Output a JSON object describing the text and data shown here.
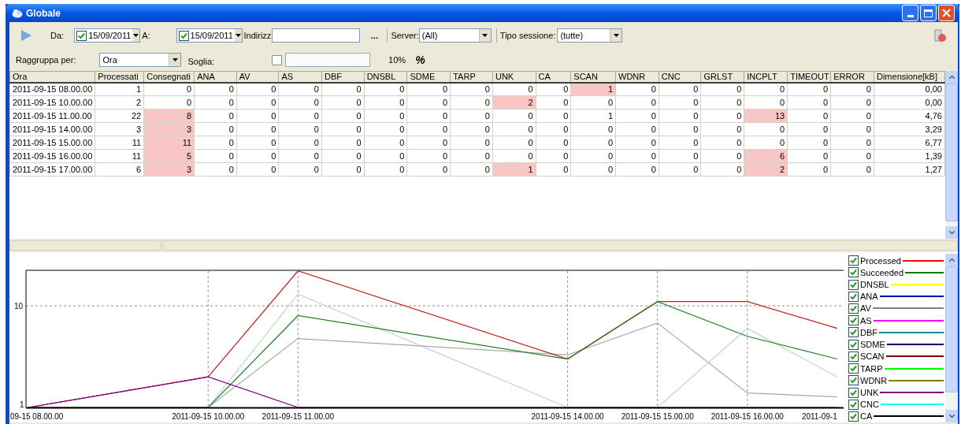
{
  "window": {
    "title": "Globale"
  },
  "toolbar": {
    "from_label": "Da:",
    "from_date": {
      "checked": true,
      "value": "15/09/2011"
    },
    "to_label": "A:",
    "to_date": {
      "checked": true,
      "value": "15/09/2011"
    },
    "address_label": "Indirizz",
    "browse_button": "...",
    "server_label": "Server:",
    "server": "(All)",
    "session_label": "Tipo sessione:",
    "session": "(tutte)"
  },
  "grouping": {
    "label": "Raggruppa per:",
    "value": "Ora",
    "threshold_label": "Soglia:",
    "threshold_checked": false,
    "threshold_percent": "10%",
    "percent_button": "%"
  },
  "table": {
    "columns": [
      "Ora",
      "Processati",
      "Consegnati",
      "ANA",
      "AV",
      "AS",
      "DBF",
      "DNSBL",
      "SDME",
      "TARP",
      "UNK",
      "CA",
      "SCAN",
      "WDNR",
      "CNC",
      "GRLST",
      "INCPLT",
      "TIMEOUT",
      "ERROR",
      "Dimensione[kB]"
    ],
    "rows": [
      [
        "2011-09-15 08.00.00",
        "1",
        "0",
        "0",
        "0",
        "0",
        "0",
        "0",
        "0",
        "0",
        "0",
        "0",
        {
          "text": "1",
          "highlighted": true
        },
        "0",
        "0",
        "0",
        "0",
        "0",
        "0",
        "0,00"
      ],
      [
        "2011-09-15 10.00.00",
        "2",
        "0",
        "0",
        "0",
        "0",
        "0",
        "0",
        "0",
        "0",
        {
          "text": "2",
          "highlighted": true
        },
        "0",
        "0",
        "0",
        "0",
        "0",
        "0",
        "0",
        "0",
        "0,00"
      ],
      [
        "2011-09-15 11.00.00",
        "22",
        {
          "text": "8",
          "highlighted": true
        },
        "0",
        "0",
        "0",
        "0",
        "0",
        "0",
        "0",
        "0",
        "0",
        "1",
        "0",
        "0",
        "0",
        {
          "text": "13",
          "highlighted": true
        },
        "0",
        "0",
        "4,76"
      ],
      [
        "2011-09-15 14.00.00",
        "3",
        {
          "text": "3",
          "highlighted": true
        },
        "0",
        "0",
        "0",
        "0",
        "0",
        "0",
        "0",
        "0",
        "0",
        "0",
        "0",
        "0",
        "0",
        "0",
        "0",
        "0",
        "3,29"
      ],
      [
        "2011-09-15 15.00.00",
        "11",
        {
          "text": "11",
          "highlighted": true
        },
        "0",
        "0",
        "0",
        "0",
        "0",
        "0",
        "0",
        "0",
        "0",
        "0",
        "0",
        "0",
        "0",
        "0",
        "0",
        "0",
        "6,77"
      ],
      [
        "2011-09-15 16.00.00",
        "11",
        {
          "text": "5",
          "highlighted": true
        },
        "0",
        "0",
        "0",
        "0",
        "0",
        "0",
        "0",
        "0",
        "0",
        "0",
        "0",
        "0",
        "0",
        {
          "text": "6",
          "highlighted": true
        },
        "0",
        "0",
        "1,39"
      ],
      [
        "2011-09-15 17.00.00",
        "6",
        {
          "text": "3",
          "highlighted": true
        },
        "0",
        "0",
        "0",
        "0",
        "0",
        "0",
        "0",
        {
          "text": "1",
          "highlighted": true
        },
        "0",
        "0",
        "0",
        "0",
        "0",
        {
          "text": "2",
          "highlighted": true
        },
        "0",
        "0",
        "1,27"
      ]
    ]
  },
  "chart": {
    "x_labels": [
      "09-15 08.00.00",
      "2011-09-15 10.00.00",
      "2011-09-15 11.00.00",
      "2011-09-15 14.00.00",
      "2011-09-15 15.00.00",
      "2011-09-15 16.00.00",
      "2011-09-1"
    ],
    "y_labels": [
      "10",
      "1"
    ],
    "legend": [
      {
        "label": "Processed",
        "checked": true,
        "color": "#ff0000"
      },
      {
        "label": "Succeeded",
        "checked": true,
        "color": "#008000"
      },
      {
        "label": "DNSBL",
        "checked": true,
        "color": "#ffff00"
      },
      {
        "label": "ANA",
        "checked": true,
        "color": "#0000c0"
      },
      {
        "label": "AV",
        "checked": true,
        "color": "#808080"
      },
      {
        "label": "AS",
        "checked": true,
        "color": "#ff00ff"
      },
      {
        "label": "DBF",
        "checked": true,
        "color": "#009090"
      },
      {
        "label": "SDME",
        "checked": true,
        "color": "#000060"
      },
      {
        "label": "SCAN",
        "checked": true,
        "color": "#800000"
      },
      {
        "label": "TARP",
        "checked": true,
        "color": "#00ff00"
      },
      {
        "label": "WDNR",
        "checked": true,
        "color": "#808000"
      },
      {
        "label": "UNK",
        "checked": true,
        "color": "#800080"
      },
      {
        "label": "CNC",
        "checked": true,
        "color": "#00ffff"
      },
      {
        "label": "CA",
        "checked": true,
        "color": "#000000"
      }
    ]
  }
}
